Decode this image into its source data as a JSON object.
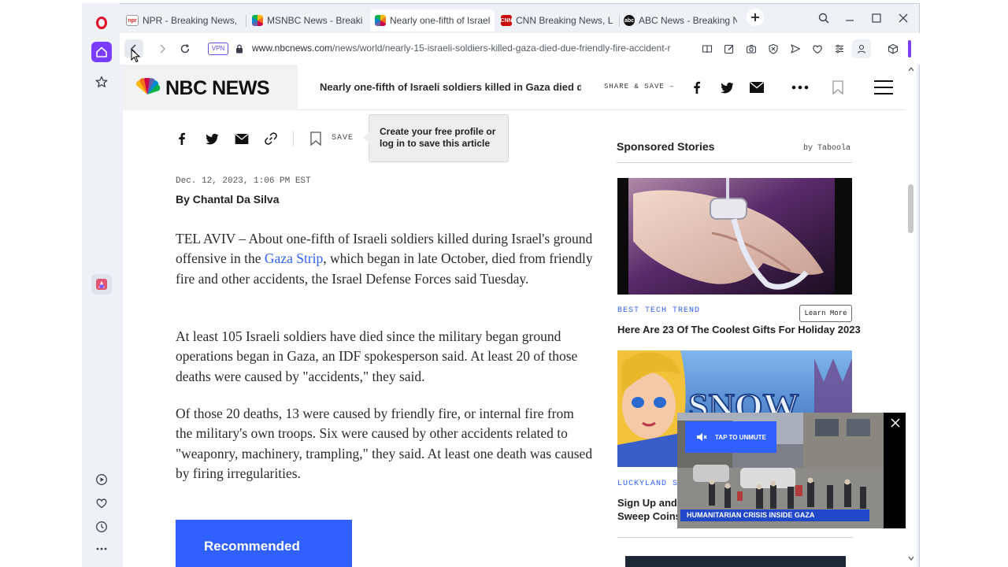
{
  "browser": {
    "tabs": [
      {
        "label": "NPR - Breaking News, Ana",
        "favicon": "npr-favicon",
        "active": false
      },
      {
        "label": "MSNBC News - Breaking N",
        "favicon": "peacock-favicon",
        "active": false
      },
      {
        "label": "Nearly one-fifth of Israeli s",
        "favicon": "peacock-favicon",
        "active": true
      },
      {
        "label": "CNN Breaking News, Latest New",
        "favicon": "cnn-favicon",
        "active": false
      },
      {
        "label": "ABC News - Breaking New",
        "favicon": "abc-favicon",
        "active": false
      }
    ],
    "vpn_label": "VPN",
    "url_host": "www.nbcnews.com",
    "url_path": "/news/world/nearly-15-israeli-soldiers-killed-gaza-died-due-friendly-fire-accident-r",
    "accent_color": "#7a3cff"
  },
  "site": {
    "logo_text": "NBC NEWS",
    "sticky_headline": "Nearly one-fifth of Israeli soldiers killed in Gaza died due to friendly fire",
    "share_save_label": "SHARE & SAVE –"
  },
  "article": {
    "save_label": "SAVE",
    "tooltip": "Create your free profile or log in to save this article",
    "date": "Dec. 12, 2023, 1:06 PM EST",
    "byline": "By Chantal Da Silva",
    "p1_before": "TEL AVIV – About one-fifth of Israeli soldiers killed during Israel's ground offensive in the ",
    "p1_link": "Gaza Strip",
    "p1_after": ", which began in late October, died from friendly fire and other accidents, the Israel Defense Forces said Tuesday.",
    "p2": "At least 105 Israeli soldiers have died since the military began ground operations began in Gaza, an IDF spokesperson said. At least 20 of those deaths were caused by \"accidents,\" they said.",
    "p3": "Of those 20 deaths, 13 were caused by friendly fire, or internal fire from the military's own troops. Six were caused by other accidents related to \"weaponry, machinery, trampling,\" they said. At least one death was caused by firing irregularities.",
    "recommended_label": "Recommended"
  },
  "rail": {
    "heading": "Sponsored Stories",
    "by": "by Taboola",
    "story1_category": "BEST TECH TREND",
    "story1_cta": "Learn More",
    "story1_title": "Here Are 23 Of The Coolest Gifts For Holiday 2023",
    "story2_category": "LUCKYLAND SL",
    "story2_title_line1": "Sign Up and C",
    "story2_title_line2": "Sweep Coins",
    "story2_art_text": "SNOW"
  },
  "video": {
    "unmute_label": "TAP TO UNMUTE",
    "lower_third": "HUMANITARIAN CRISIS INSIDE GAZA"
  }
}
